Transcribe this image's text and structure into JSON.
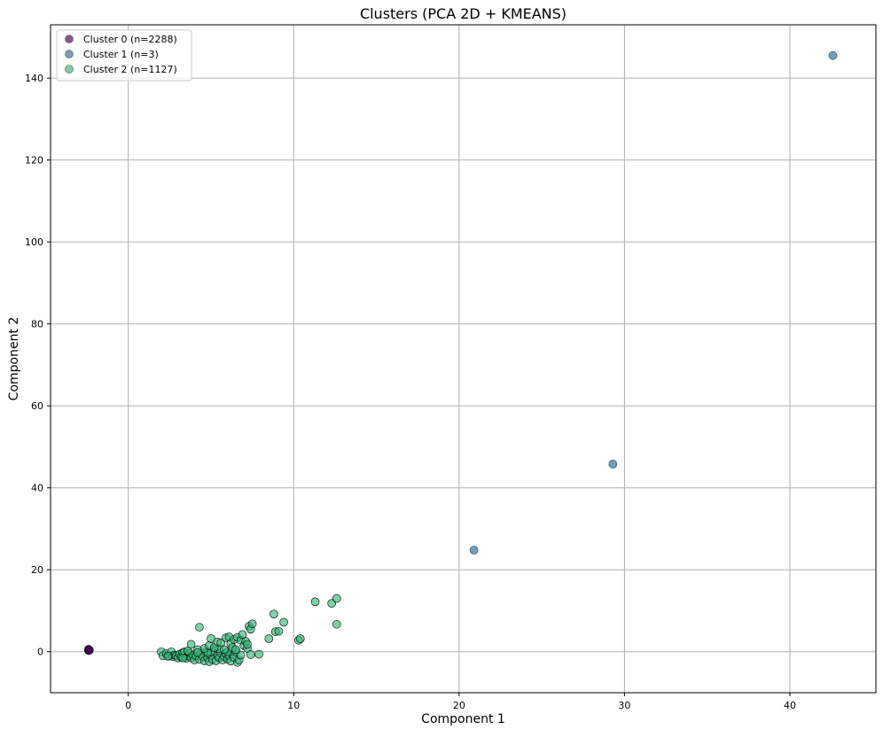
{
  "chart_data": {
    "type": "scatter",
    "title": "Clusters (PCA 2D + KMEANS)",
    "xlabel": "Component 1",
    "ylabel": "Component 2",
    "xlim": [
      -4.7,
      45.2
    ],
    "ylim": [
      -10,
      153
    ],
    "xticks": [
      0,
      10,
      20,
      30,
      40
    ],
    "yticks": [
      0,
      20,
      40,
      60,
      80,
      100,
      120,
      140
    ],
    "grid": true,
    "legend_position": "top-left",
    "series": [
      {
        "name": "Cluster 0 (n=2288)",
        "color": "#440154",
        "points": [
          [
            -2.4,
            0.5
          ],
          [
            -2.4,
            0.3
          ],
          [
            -2.4,
            0.6
          ],
          [
            -2.35,
            0.4
          ]
        ]
      },
      {
        "name": "Cluster 1 (n=3)",
        "color": "#31688e",
        "points": [
          [
            42.6,
            145.5
          ],
          [
            29.3,
            45.8
          ],
          [
            20.9,
            24.8
          ]
        ]
      },
      {
        "name": "Cluster 2 (n=1127)",
        "color": "#35b779",
        "points": [
          [
            2.0,
            0.0
          ],
          [
            2.1,
            -1.0
          ],
          [
            2.3,
            -0.5
          ],
          [
            2.5,
            -1.0
          ],
          [
            2.6,
            0.0
          ],
          [
            2.7,
            -1.2
          ],
          [
            2.8,
            -0.8
          ],
          [
            2.9,
            -1.0
          ],
          [
            3.0,
            -1.5
          ],
          [
            3.1,
            -0.6
          ],
          [
            3.2,
            -1.3
          ],
          [
            3.3,
            -0.2
          ],
          [
            3.4,
            0.0
          ],
          [
            3.5,
            -1.6
          ],
          [
            3.6,
            -1.0
          ],
          [
            3.7,
            -0.4
          ],
          [
            3.8,
            -1.5
          ],
          [
            3.9,
            -0.8
          ],
          [
            4.0,
            -2.0
          ],
          [
            4.1,
            -1.0
          ],
          [
            4.2,
            0.5
          ],
          [
            4.3,
            -1.8
          ],
          [
            4.4,
            -0.6
          ],
          [
            4.5,
            -1.2
          ],
          [
            4.6,
            -2.2
          ],
          [
            4.7,
            0.0
          ],
          [
            4.8,
            -1.5
          ],
          [
            4.9,
            -2.4
          ],
          [
            5.0,
            -0.8
          ],
          [
            5.1,
            -1.9
          ],
          [
            5.2,
            0.3
          ],
          [
            5.3,
            -2.2
          ],
          [
            5.4,
            -1.0
          ],
          [
            5.5,
            -1.5
          ],
          [
            5.6,
            -0.3
          ],
          [
            5.7,
            -2.0
          ],
          [
            5.8,
            -1.2
          ],
          [
            5.9,
            -0.5
          ],
          [
            6.0,
            -1.8
          ],
          [
            6.1,
            -1.0
          ],
          [
            6.2,
            -2.3
          ],
          [
            6.3,
            -0.6
          ],
          [
            6.4,
            -1.4
          ],
          [
            6.5,
            0.0
          ],
          [
            6.6,
            -2.6
          ],
          [
            6.7,
            -2.0
          ],
          [
            6.8,
            -0.8
          ],
          [
            3.6,
            0.2
          ],
          [
            4.2,
            -0.2
          ],
          [
            5.0,
            0.0
          ],
          [
            5.5,
            0.7
          ],
          [
            6.0,
            0.0
          ],
          [
            2.4,
            -1.1
          ],
          [
            3.3,
            -1.5
          ],
          [
            4.8,
            -0.2
          ],
          [
            3.8,
            1.8
          ],
          [
            4.3,
            6.0
          ],
          [
            4.6,
            0.8
          ],
          [
            4.9,
            1.5
          ],
          [
            5.0,
            3.2
          ],
          [
            5.2,
            1.0
          ],
          [
            5.4,
            2.4
          ],
          [
            5.6,
            2.2
          ],
          [
            5.8,
            0.5
          ],
          [
            5.9,
            3.4
          ],
          [
            6.1,
            3.6
          ],
          [
            6.2,
            2.0
          ],
          [
            6.3,
            1.0
          ],
          [
            6.4,
            3.0
          ],
          [
            6.5,
            0.5
          ],
          [
            6.6,
            3.5
          ],
          [
            6.8,
            2.8
          ],
          [
            6.9,
            4.2
          ],
          [
            7.0,
            1.5
          ],
          [
            7.1,
            2.5
          ],
          [
            7.2,
            0.8
          ],
          [
            7.3,
            6.2
          ],
          [
            7.4,
            5.5
          ],
          [
            7.5,
            6.8
          ],
          [
            7.2,
            1.8
          ],
          [
            7.4,
            -0.7
          ],
          [
            7.9,
            -0.6
          ],
          [
            8.5,
            3.2
          ],
          [
            8.8,
            9.2
          ],
          [
            8.9,
            4.9
          ],
          [
            9.1,
            5.0
          ],
          [
            9.4,
            7.2
          ],
          [
            10.3,
            2.8
          ],
          [
            10.4,
            3.2
          ],
          [
            11.3,
            12.2
          ],
          [
            12.3,
            11.8
          ],
          [
            12.6,
            13.0
          ],
          [
            12.6,
            6.7
          ]
        ]
      }
    ]
  }
}
